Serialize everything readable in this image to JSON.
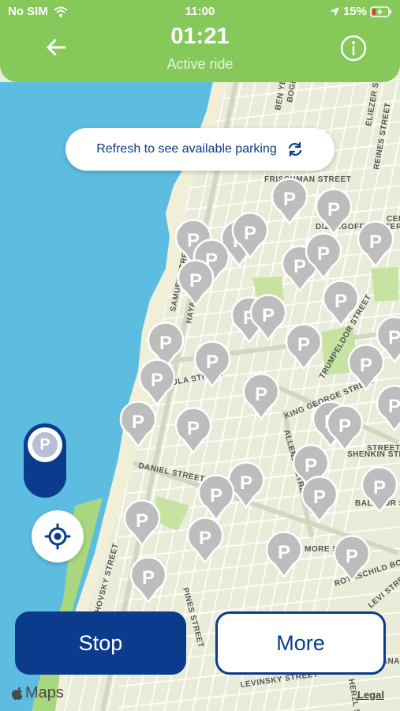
{
  "status_bar": {
    "carrier": "No SIM",
    "time": "11:00",
    "battery": "15%"
  },
  "header": {
    "timer": "01:21",
    "subtitle": "Active ride",
    "color": "#86c85a"
  },
  "refresh": {
    "label": "Refresh to see available parking"
  },
  "parking_toggle": {
    "letter": "P"
  },
  "actions": {
    "stop_label": "Stop",
    "more_label": "More"
  },
  "map": {
    "attribution": "Maps",
    "legal": "Legal",
    "street_labels": [
      "FRISCHMAN STREET",
      "SAMUEL STREET",
      "HAYARKON",
      "GEULA STREET",
      "KING GEORGE STREET",
      "ALLENBY STREET",
      "DANIEL STREET",
      "TRUMPELDOR STREET",
      "PINES STREET",
      "ROTHSCHILD BOULEVARD",
      "LEVINSKY STREET",
      "TCHERNICHOVSKY STREET",
      "REINES STREET",
      "DIZENGOFF CENTER",
      "SHENKIN STREET",
      "LEVI STREET",
      "BALFOUR STREET",
      "HERZL STREET",
      "HAGANA STREET",
      "BEN YEHUDA STREET",
      "BOGRASHOV STREET",
      "ELIEZER STREET",
      "CENTRAL PEAK",
      "STREET",
      "MORE STREET"
    ],
    "parking_marker_label": "P",
    "parking_marker_count": 37
  },
  "colors": {
    "primary": "#0a3b8c",
    "marker": "#bdbdbd",
    "sea": "#5cbde0",
    "land": "#e9ecd8",
    "park": "#c6e3a2"
  }
}
